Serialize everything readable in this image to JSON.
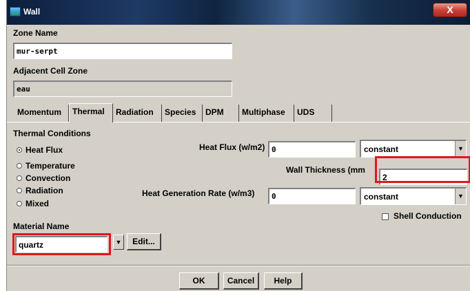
{
  "window": {
    "title": "Wall",
    "close_label": "X"
  },
  "zone_name": {
    "label": "Zone Name",
    "value": "mur-serpt"
  },
  "adjacent_cell_zone": {
    "label": "Adjacent Cell Zone",
    "value": "eau"
  },
  "tabs": [
    {
      "label": "Momentum",
      "active": false
    },
    {
      "label": "Thermal",
      "active": true
    },
    {
      "label": "Radiation",
      "active": false
    },
    {
      "label": "Species",
      "active": false
    },
    {
      "label": "DPM",
      "active": false
    },
    {
      "label": "Multiphase",
      "active": false
    },
    {
      "label": "UDS",
      "active": false
    }
  ],
  "thermal": {
    "conditions_label": "Thermal Conditions",
    "options": [
      {
        "label": "Heat Flux",
        "selected": true
      },
      {
        "label": "Temperature",
        "selected": false
      },
      {
        "label": "Convection",
        "selected": false
      },
      {
        "label": "Radiation",
        "selected": false
      },
      {
        "label": "Mixed",
        "selected": false
      }
    ],
    "heat_flux": {
      "label": "Heat Flux (w/m2)",
      "value": "0",
      "method": "constant"
    },
    "wall_thickness": {
      "label": "Wall Thickness (mm",
      "value": "2"
    },
    "heat_generation": {
      "label": "Heat Generation Rate (w/m3)",
      "value": "0",
      "method": "constant"
    },
    "shell_conduction": {
      "label": "Shell Conduction",
      "checked": false
    }
  },
  "material": {
    "label": "Material Name",
    "value": "quartz",
    "edit_label": "Edit..."
  },
  "buttons": {
    "ok": "OK",
    "cancel": "Cancel",
    "help": "Help"
  },
  "colors": {
    "highlight": "#e4141e",
    "dialog_bg": "#d4d0c8"
  },
  "icons": {
    "dropdown": "▼"
  }
}
